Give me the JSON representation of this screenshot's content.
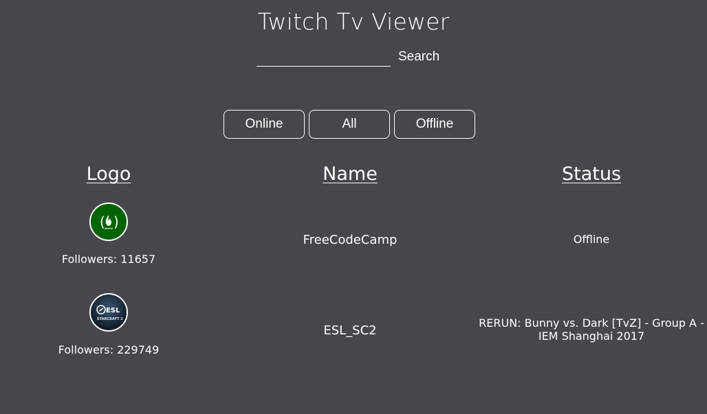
{
  "app": {
    "title": "Twitch Tv Viewer"
  },
  "search": {
    "placeholder": "",
    "value": "",
    "button_label": "Search"
  },
  "filters": [
    {
      "label": "Online"
    },
    {
      "label": "All"
    },
    {
      "label": "Offline"
    }
  ],
  "table": {
    "headers": {
      "logo": "Logo",
      "name": "Name",
      "status": "Status"
    },
    "rows": [
      {
        "logo_icon": "freecodecamp-logo-icon",
        "followers": "Followers: 11657",
        "name": "FreeCodeCamp",
        "status": "Offline"
      },
      {
        "logo_icon": "esl-starcraft2-logo-icon",
        "followers": "Followers: 229749",
        "name": "ESL_SC2",
        "status": "RERUN: Bunny vs. Dark [TvZ] - Group A - IEM Shanghai 2017"
      }
    ]
  },
  "colors": {
    "background": "#45474c",
    "text": "#ffffff",
    "freecodecamp_green": "#006400",
    "esl_dark": "#1a2a3a"
  }
}
